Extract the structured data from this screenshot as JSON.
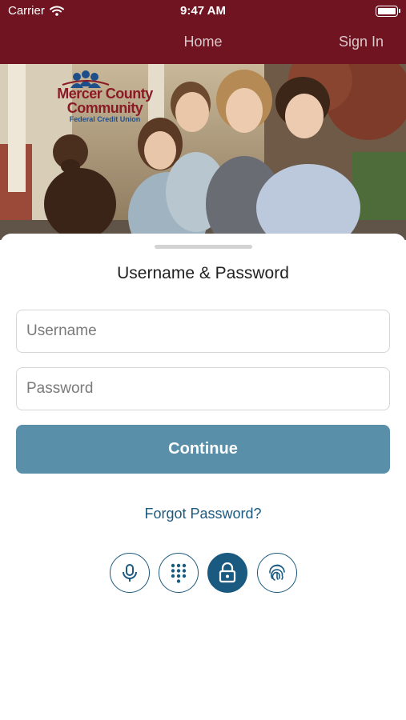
{
  "status_bar": {
    "carrier": "Carrier",
    "time": "9:47 AM"
  },
  "nav": {
    "title": "Home",
    "sign_in": "Sign In"
  },
  "hero": {
    "logo_line1": "Mercer County",
    "logo_line2": "Community",
    "logo_line3": "Federal Credit Union"
  },
  "login": {
    "title": "Username & Password",
    "username_placeholder": "Username",
    "password_placeholder": "Password",
    "continue_label": "Continue",
    "forgot_label": "Forgot Password?"
  },
  "auth_methods": [
    {
      "icon": "microphone-icon",
      "active": false
    },
    {
      "icon": "keypad-icon",
      "active": false
    },
    {
      "icon": "lock-icon",
      "active": true
    },
    {
      "icon": "fingerprint-icon",
      "active": false
    }
  ],
  "colors": {
    "brand": "#6f1420",
    "button": "#5a8faa",
    "accent": "#1b5a80"
  }
}
